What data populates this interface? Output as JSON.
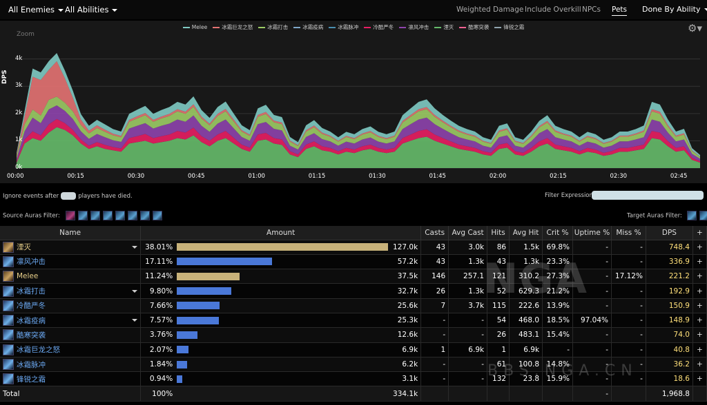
{
  "topbar": {
    "enemies": "All Enemies",
    "abilities": "All Abilities",
    "weighted": "Weighted Damage",
    "overkill": "Include Overkill",
    "npcs": "NPCs",
    "pets": "Pets",
    "done_by": "Done By Ability"
  },
  "chart_data": {
    "type": "area",
    "ylabel": "DPS",
    "yticks": [
      "0k",
      "1k",
      "2k",
      "3k",
      "4k"
    ],
    "xticks": [
      "00:00",
      "00:15",
      "00:30",
      "00:45",
      "01:00",
      "01:15",
      "01:30",
      "01:45",
      "02:00",
      "02:15",
      "02:30",
      "02:45"
    ],
    "ylim": [
      0,
      4800
    ],
    "zoom_label": "Zoom",
    "legend_placement": "top",
    "legend": [
      {
        "name": "Melee",
        "color": "#80cbc4"
      },
      {
        "name": "冰霜巨龙之怒",
        "color": "#e57373"
      },
      {
        "name": "冰霜打击",
        "color": "#9ccc65"
      },
      {
        "name": "冰霜疫病",
        "color": "#7fa8c9"
      },
      {
        "name": "冰霜脉冲",
        "color": "#4a8fb0"
      },
      {
        "name": "冷酷严冬",
        "color": "#e91e63"
      },
      {
        "name": "凛风冲击",
        "color": "#8e44ad"
      },
      {
        "name": "湮灭",
        "color": "#66bb6a"
      },
      {
        "name": "酷寒突袭",
        "color": "#f06292"
      },
      {
        "name": "锋锐之霜",
        "color": "#90a4ae"
      }
    ],
    "x": [
      0,
      2,
      4,
      6,
      8,
      10,
      12,
      14,
      16,
      18,
      20,
      22,
      24,
      26,
      28,
      30,
      32,
      34,
      36,
      38,
      40,
      42,
      44,
      46,
      48,
      50,
      52,
      54,
      56,
      58,
      60,
      62,
      64,
      66,
      68,
      70,
      72,
      74,
      76,
      78,
      80,
      82,
      84,
      86,
      88,
      90,
      92,
      94,
      96,
      98,
      100,
      102,
      104,
      106,
      108,
      110,
      112,
      114,
      116,
      118,
      120,
      122,
      124,
      126,
      128,
      130,
      132,
      134,
      136,
      138,
      140,
      142,
      144,
      146,
      148,
      150,
      152,
      154,
      156,
      158,
      160,
      162,
      164,
      166,
      168,
      170
    ],
    "series": [
      {
        "name": "湮灭",
        "values": [
          200,
          900,
          1100,
          1000,
          1300,
          1500,
          1400,
          1200,
          900,
          700,
          800,
          700,
          650,
          600,
          900,
          950,
          1000,
          900,
          950,
          1000,
          1100,
          1050,
          1200,
          950,
          800,
          1000,
          1100,
          900,
          700,
          600,
          1000,
          1050,
          900,
          850,
          500,
          400,
          700,
          800,
          650,
          600,
          500,
          600,
          550,
          650,
          700,
          600,
          550,
          600,
          900,
          1000,
          1100,
          1150,
          1000,
          900,
          800,
          700,
          650,
          600,
          500,
          450,
          700,
          750,
          500,
          450,
          600,
          800,
          900,
          700,
          650,
          600,
          500,
          600,
          550,
          450,
          500,
          600,
          600,
          650,
          700,
          1100,
          1050,
          800,
          600,
          650,
          300,
          200
        ]
      },
      {
        "name": "冷酷严冬",
        "values": [
          50,
          150,
          250,
          200,
          300,
          300,
          250,
          200,
          150,
          120,
          150,
          150,
          120,
          120,
          200,
          220,
          250,
          200,
          220,
          230,
          260,
          250,
          280,
          220,
          200,
          230,
          260,
          210,
          160,
          150,
          230,
          240,
          200,
          200,
          120,
          100,
          160,
          180,
          150,
          140,
          120,
          140,
          130,
          150,
          160,
          140,
          130,
          140,
          200,
          230,
          260,
          270,
          230,
          200,
          180,
          160,
          150,
          140,
          120,
          110,
          160,
          170,
          120,
          110,
          140,
          180,
          200,
          160,
          150,
          140,
          120,
          140,
          130,
          110,
          120,
          140,
          140,
          150,
          160,
          260,
          250,
          190,
          140,
          150,
          80,
          50
        ]
      },
      {
        "name": "凛风冲击",
        "values": [
          100,
          300,
          500,
          450,
          550,
          500,
          450,
          400,
          300,
          250,
          300,
          280,
          250,
          240,
          350,
          380,
          400,
          350,
          380,
          400,
          420,
          400,
          450,
          380,
          330,
          400,
          420,
          350,
          280,
          250,
          380,
          400,
          340,
          330,
          200,
          180,
          280,
          300,
          260,
          240,
          200,
          230,
          220,
          250,
          260,
          230,
          220,
          240,
          330,
          380,
          420,
          430,
          380,
          340,
          300,
          270,
          250,
          240,
          200,
          190,
          270,
          280,
          200,
          190,
          240,
          300,
          330,
          270,
          250,
          240,
          200,
          230,
          220,
          190,
          200,
          240,
          240,
          250,
          270,
          420,
          400,
          310,
          240,
          250,
          140,
          90
        ]
      },
      {
        "name": "冰霜打击",
        "values": [
          100,
          250,
          300,
          280,
          350,
          320,
          300,
          280,
          230,
          200,
          220,
          200,
          180,
          170,
          250,
          270,
          290,
          250,
          270,
          280,
          300,
          290,
          320,
          270,
          240,
          280,
          300,
          250,
          200,
          180,
          270,
          290,
          240,
          230,
          150,
          130,
          200,
          220,
          190,
          170,
          150,
          170,
          160,
          180,
          190,
          170,
          160,
          170,
          240,
          270,
          300,
          310,
          270,
          240,
          220,
          200,
          180,
          170,
          150,
          140,
          200,
          210,
          150,
          140,
          170,
          210,
          240,
          200,
          180,
          170,
          150,
          170,
          160,
          140,
          150,
          170,
          170,
          180,
          200,
          300,
          290,
          220,
          170,
          180,
          100,
          70
        ]
      },
      {
        "name": "冰霜巨龙之怒",
        "values": [
          50,
          300,
          1200,
          1300,
          1100,
          1300,
          900,
          500,
          200,
          100,
          100,
          80,
          60,
          50,
          70,
          80,
          80,
          70,
          70,
          80,
          80,
          80,
          90,
          70,
          60,
          80,
          90,
          70,
          50,
          50,
          70,
          80,
          60,
          60,
          40,
          30,
          50,
          60,
          50,
          40,
          30,
          40,
          40,
          40,
          50,
          40,
          40,
          40,
          60,
          70,
          80,
          80,
          70,
          60,
          50,
          50,
          40,
          40,
          30,
          30,
          50,
          50,
          30,
          30,
          40,
          50,
          60,
          50,
          40,
          40,
          30,
          40,
          40,
          30,
          30,
          40,
          40,
          40,
          50,
          80,
          80,
          60,
          40,
          50,
          20,
          10
        ]
      },
      {
        "name": "Melee",
        "values": [
          60,
          200,
          300,
          280,
          320,
          300,
          280,
          260,
          200,
          180,
          200,
          190,
          170,
          160,
          220,
          240,
          260,
          220,
          240,
          250,
          270,
          260,
          290,
          240,
          210,
          250,
          270,
          220,
          180,
          160,
          240,
          260,
          210,
          200,
          130,
          110,
          180,
          200,
          170,
          150,
          130,
          150,
          140,
          160,
          170,
          150,
          140,
          150,
          210,
          240,
          270,
          280,
          240,
          210,
          190,
          170,
          160,
          150,
          130,
          120,
          170,
          180,
          130,
          120,
          150,
          190,
          210,
          170,
          160,
          150,
          130,
          150,
          140,
          120,
          130,
          150,
          150,
          160,
          180,
          270,
          260,
          200,
          150,
          160,
          90,
          60
        ]
      }
    ]
  },
  "controls": {
    "ignore_before": "Ignore events after",
    "ignore_after": "players have died.",
    "filter_expr": "Filter Expression:",
    "source_auras": "Source Auras Filter:",
    "target_auras": "Target Auras Filter:"
  },
  "table": {
    "headers": [
      "Name",
      "Amount",
      "Casts",
      "Avg Cast",
      "Hits",
      "Avg Hit",
      "Crit %",
      "Uptime %",
      "Miss %",
      "DPS",
      "+"
    ],
    "rows": [
      {
        "name": "湮灭",
        "dd": true,
        "pct": "38.01%",
        "frac": 1.0,
        "bar": "#c8b27a",
        "amount": "127.0k",
        "casts": "43",
        "avgcast": "3.0k",
        "hits": "86",
        "avghit": "1.5k",
        "crit": "69.8%",
        "uptime": "-",
        "miss": "-",
        "dps": "748.4",
        "gold": true
      },
      {
        "name": "凛风冲击",
        "dd": false,
        "pct": "17.11%",
        "frac": 0.45,
        "bar": "#4a78d8",
        "amount": "57.2k",
        "casts": "43",
        "avgcast": "1.3k",
        "hits": "43",
        "avghit": "1.3k",
        "crit": "23.3%",
        "uptime": "-",
        "miss": "-",
        "dps": "336.9",
        "gold": false
      },
      {
        "name": "Melee",
        "dd": false,
        "pct": "11.24%",
        "frac": 0.296,
        "bar": "#c8b27a",
        "amount": "37.5k",
        "casts": "146",
        "avgcast": "257.1",
        "hits": "121",
        "avghit": "310.2",
        "crit": "27.3%",
        "uptime": "-",
        "miss": "17.12%",
        "dps": "221.2",
        "gold": true
      },
      {
        "name": "冰霜打击",
        "dd": true,
        "pct": "9.80%",
        "frac": 0.258,
        "bar": "#4a78d8",
        "amount": "32.7k",
        "casts": "26",
        "avgcast": "1.3k",
        "hits": "52",
        "avghit": "629.3",
        "crit": "21.2%",
        "uptime": "-",
        "miss": "-",
        "dps": "192.9",
        "gold": false
      },
      {
        "name": "冷酷严冬",
        "dd": false,
        "pct": "7.66%",
        "frac": 0.202,
        "bar": "#4a78d8",
        "amount": "25.6k",
        "casts": "7",
        "avgcast": "3.7k",
        "hits": "115",
        "avghit": "222.6",
        "crit": "13.9%",
        "uptime": "-",
        "miss": "-",
        "dps": "150.9",
        "gold": false
      },
      {
        "name": "冰霜疫病",
        "dd": true,
        "pct": "7.57%",
        "frac": 0.199,
        "bar": "#4a78d8",
        "amount": "25.3k",
        "casts": "-",
        "avgcast": "-",
        "hits": "54",
        "avghit": "468.0",
        "crit": "18.5%",
        "uptime": "97.04%",
        "miss": "-",
        "dps": "148.9",
        "gold": false
      },
      {
        "name": "酷寒突袭",
        "dd": false,
        "pct": "3.76%",
        "frac": 0.099,
        "bar": "#4a78d8",
        "amount": "12.6k",
        "casts": "-",
        "avgcast": "-",
        "hits": "26",
        "avghit": "483.1",
        "crit": "15.4%",
        "uptime": "-",
        "miss": "-",
        "dps": "74.0",
        "gold": false
      },
      {
        "name": "冰霜巨龙之怒",
        "dd": false,
        "pct": "2.07%",
        "frac": 0.054,
        "bar": "#4a78d8",
        "amount": "6.9k",
        "casts": "1",
        "avgcast": "6.9k",
        "hits": "1",
        "avghit": "6.9k",
        "crit": "-",
        "uptime": "-",
        "miss": "-",
        "dps": "40.8",
        "gold": false
      },
      {
        "name": "冰霜脉冲",
        "dd": false,
        "pct": "1.84%",
        "frac": 0.048,
        "bar": "#4a78d8",
        "amount": "6.2k",
        "casts": "-",
        "avgcast": "-",
        "hits": "61",
        "avghit": "100.8",
        "crit": "14.8%",
        "uptime": "-",
        "miss": "-",
        "dps": "36.2",
        "gold": false
      },
      {
        "name": "锋锐之霜",
        "dd": false,
        "pct": "0.94%",
        "frac": 0.025,
        "bar": "#4a78d8",
        "amount": "3.1k",
        "casts": "-",
        "avgcast": "-",
        "hits": "132",
        "avghit": "23.8",
        "crit": "15.9%",
        "uptime": "-",
        "miss": "-",
        "dps": "18.6",
        "gold": false
      }
    ],
    "total": {
      "label": "Total",
      "pct": "100%",
      "amount": "334.1k",
      "uptime": "-",
      "dps": "1,968.8"
    }
  },
  "watermark": {
    "big": "NGA",
    "small": "BBS.NGA.CN"
  }
}
